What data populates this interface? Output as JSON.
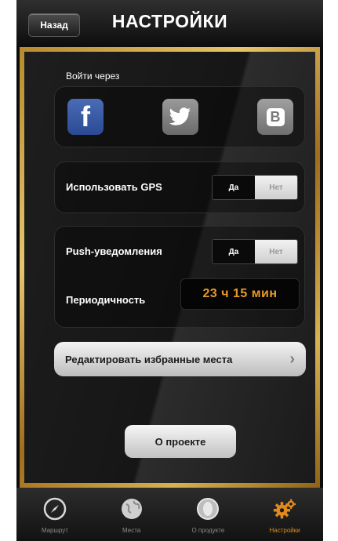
{
  "header": {
    "back_label": "Назад",
    "title": "НАСТРОЙКИ"
  },
  "login": {
    "label": "Войти через",
    "services": [
      {
        "name": "Facebook",
        "icon": "facebook-icon",
        "glyph": "f",
        "color": "#3b5998"
      },
      {
        "name": "Twitter",
        "icon": "twitter-icon",
        "color": "#888888"
      },
      {
        "name": "VK",
        "icon": "vk-icon",
        "glyph": "B",
        "color": "#8a8a8a"
      }
    ]
  },
  "gps": {
    "label": "Использовать  GPS",
    "yes": "Да",
    "no": "Нет",
    "selected": "Да"
  },
  "push": {
    "label": "Push-уведомления",
    "yes": "Да",
    "no": "Нет",
    "selected": "Да"
  },
  "periodicity": {
    "label": "Периодичность",
    "value": "23 ч 15 мин"
  },
  "edit_favorites": {
    "label": "Редактировать избранные места",
    "chevron": "›"
  },
  "about": {
    "label": "О проекте"
  },
  "tabs": [
    {
      "label": "Маршрут",
      "icon": "compass-icon",
      "active": false
    },
    {
      "label": "Места",
      "icon": "globe-icon",
      "active": false
    },
    {
      "label": "О продукте",
      "icon": "product-icon",
      "active": false
    },
    {
      "label": "Настройки",
      "icon": "gears-icon",
      "active": true
    }
  ],
  "colors": {
    "accent": "#e08a1e",
    "frame_gold": "#c99a3c"
  }
}
